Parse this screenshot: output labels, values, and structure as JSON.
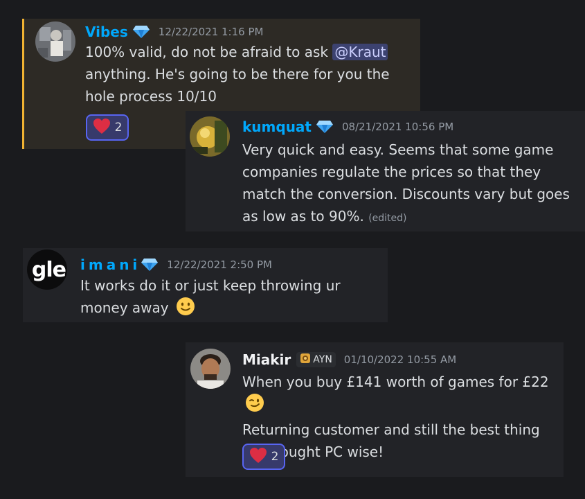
{
  "messages": [
    {
      "author": "Vibes",
      "author_color": "#00a8fc",
      "timestamp": "12/22/2021 1:16 PM",
      "text_before_mention": "100% valid, do not be afraid to ask",
      "mention": "@Kraut",
      "text_after_mention": "anything. He's going to be there for you the hole process 10/10",
      "reaction": {
        "emoji": "heart",
        "count": "2"
      },
      "highlighted": true
    },
    {
      "author": "kumquat",
      "author_color": "#00a8fc",
      "timestamp": "08/21/2021 10:56 PM",
      "text": "Very quick and easy. Seems that some game companies regulate the prices so that they match the conversion. Discounts vary but goes as low as to 90%.",
      "edited": "(edited)"
    },
    {
      "author": "imani",
      "author_color": "#00a8fc",
      "timestamp": "12/22/2021 2:50 PM",
      "avatar_text": "gle",
      "text": "It works do it or just keep throwing ur money away",
      "emoji": "slightly-smiling-face"
    },
    {
      "author": "Miakir",
      "author_color": "#f2f3f5",
      "badge": "AYN",
      "timestamp": "01/10/2022 10:55 AM",
      "line1": "When you buy £141 worth of games for £22",
      "line2": "Returning customer and still the best thing I've bought PC wise!",
      "emoji": "winking-face",
      "reaction": {
        "emoji": "heart",
        "count": "2"
      }
    }
  ],
  "icons": {
    "verified": "gem-icon",
    "badge_icon": "lion-icon"
  }
}
